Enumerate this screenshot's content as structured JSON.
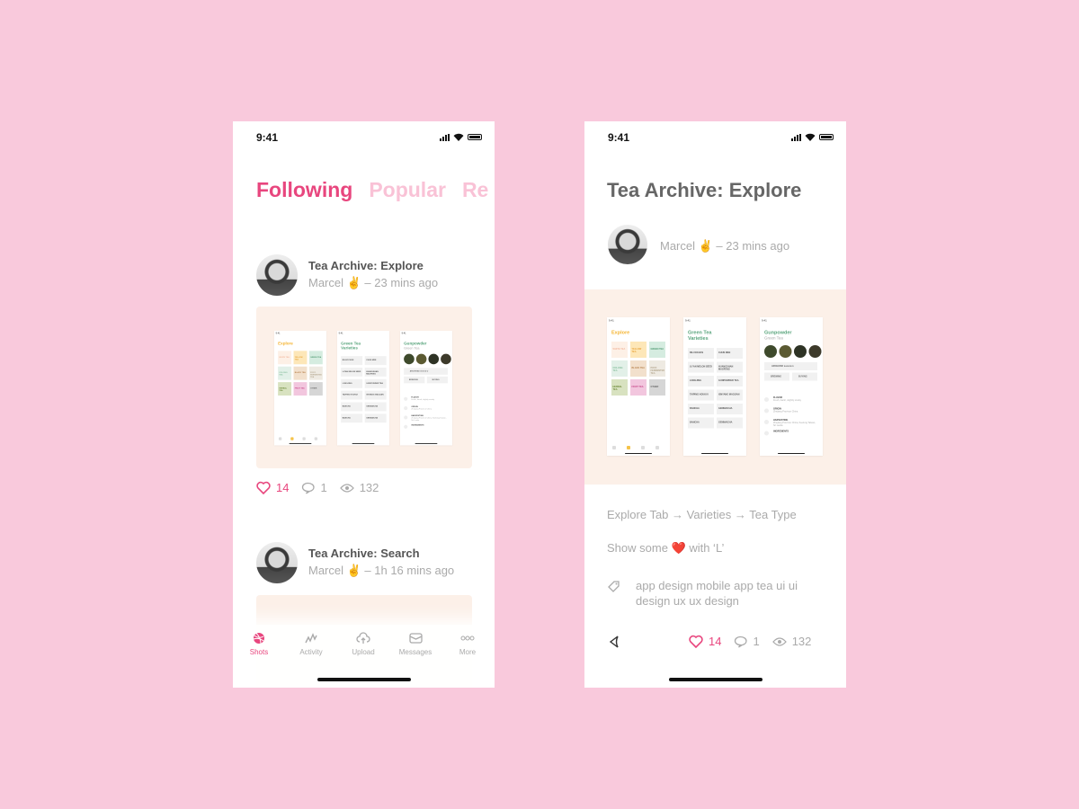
{
  "colors": {
    "background": "#f9c9dc",
    "accent": "#e8467e",
    "accent_light": "#f9c2d6",
    "card": "#fcf0e8"
  },
  "status": {
    "time": "9:41"
  },
  "feed": {
    "tabs": [
      {
        "label": "Following",
        "active": true
      },
      {
        "label": "Popular",
        "active": false
      },
      {
        "label": "Re",
        "active": false
      }
    ],
    "posts": [
      {
        "title": "Tea Archive: Explore",
        "author": "Marcel ✌️ – 23 mins ago",
        "likes": "14",
        "comments": "1",
        "views": "132"
      },
      {
        "title": "Tea Archive: Search",
        "author": "Marcel ✌️ – 1h 16 mins ago"
      }
    ],
    "tabbar": [
      {
        "label": "Shots",
        "icon": "dribbble-icon",
        "active": true
      },
      {
        "label": "Activity",
        "icon": "activity-icon"
      },
      {
        "label": "Upload",
        "icon": "upload-cloud-icon"
      },
      {
        "label": "Messages",
        "icon": "mail-icon"
      },
      {
        "label": "More",
        "icon": "more-icon"
      }
    ]
  },
  "detail": {
    "title": "Tea Archive: Explore",
    "author": "Marcel ✌️ – 23 mins ago",
    "description": "Explore Tab → Varieties → Tea Type",
    "note": "Show some ❤️ with ‘L’",
    "tags": "app design  mobile app  tea  ui ui design  ux  ux design",
    "likes": "14",
    "comments": "1",
    "views": "132"
  },
  "mockups": {
    "explore": {
      "title": "Explore",
      "tiles": [
        [
          "White Tea",
          "#fdf0e6",
          "#f2b9a0"
        ],
        [
          "Yellow Tea",
          "#fde7b8",
          "#e8a43a"
        ],
        [
          "Green Tea",
          "#d5ece0",
          "#4f9a72"
        ],
        [
          "Oolong Tea",
          "#e2f0e8",
          "#8cc2a2"
        ],
        [
          "Black Tea",
          "#f2e0cc",
          "#b88450"
        ],
        [
          "Post-Fermented Tea",
          "#eeeae2",
          "#b5a890"
        ],
        [
          "Herbal Tea",
          "#d8e2c0",
          "#6e8a3a"
        ],
        [
          "Fruit Tea",
          "#f2c6de",
          "#c84a8a"
        ],
        [
          "Other",
          "#d6d6d6",
          "#666"
        ]
      ]
    },
    "varieties": {
      "title": "Green Tea Varieties",
      "items": [
        "Biluochun",
        "Chun Mee",
        "Lu'an Melon Seed",
        "Huangshan Maofeng",
        "Longjing",
        "Gunpowder Tea",
        "Taiping Houkui",
        "Xinyang Maojian",
        "Bancha",
        "Genmaicha",
        "Bancha",
        "Genmaicha"
      ]
    },
    "type": {
      "title": "Gunpowder",
      "subtitle": "Green Tea",
      "archived": "Archived",
      "brewing": "Brewing",
      "buying": "Buying",
      "rating": 4,
      "facts": [
        [
          "Flavor",
          "Fresh, harsh, slightly smoky"
        ],
        [
          "Origin",
          "Zhejiang Province China"
        ],
        [
          "Harvesting",
          "Zhejiang Province China, Keelung Taiwan, Sri Lanka"
        ],
        [
          "Ingredients",
          ""
        ]
      ]
    }
  }
}
